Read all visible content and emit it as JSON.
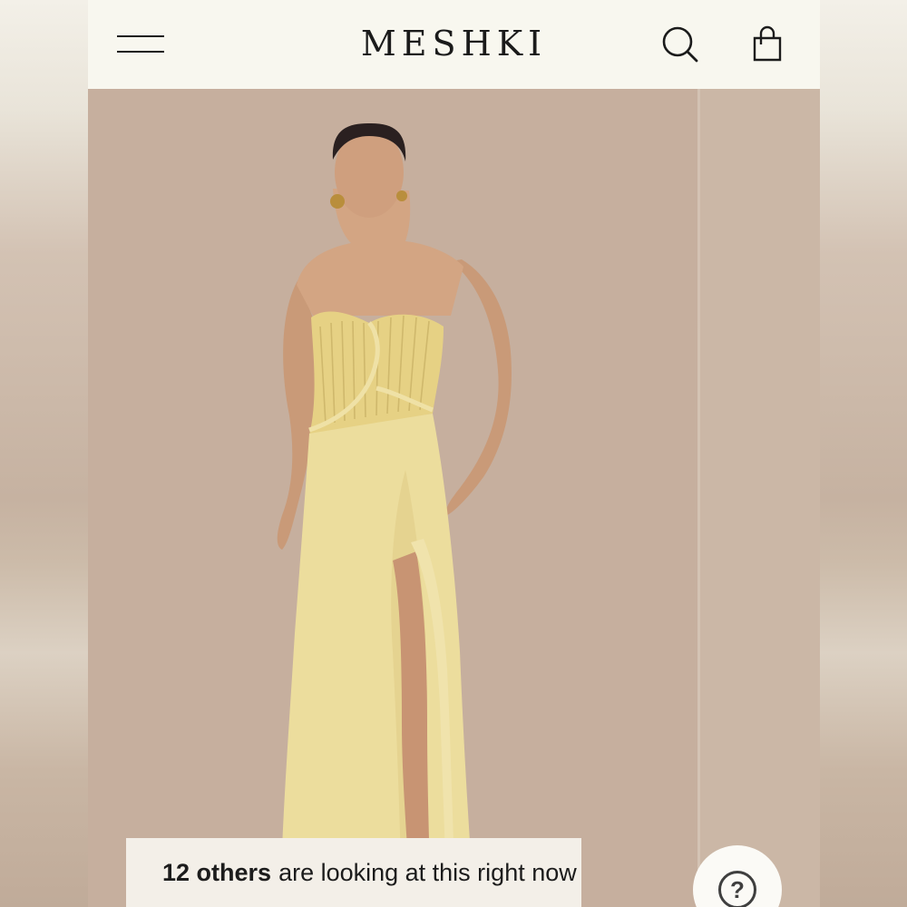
{
  "header": {
    "brand": "MESHKI",
    "menu_icon": "hamburger-menu-icon",
    "search_icon": "search-icon",
    "cart_icon": "shopping-bag-icon"
  },
  "product_gallery": {
    "image_subject": "model-in-yellow-strapless-satin-maxi-dress"
  },
  "social_proof": {
    "count_text": "12 others",
    "message": "are looking at this right now"
  },
  "help": {
    "glyph": "?",
    "icon": "help-question-icon"
  },
  "colors": {
    "header_bg": "#f8f7ef",
    "backdrop": "#c6b09f",
    "dress": "#e8d79a",
    "text": "#1b1b1b"
  }
}
